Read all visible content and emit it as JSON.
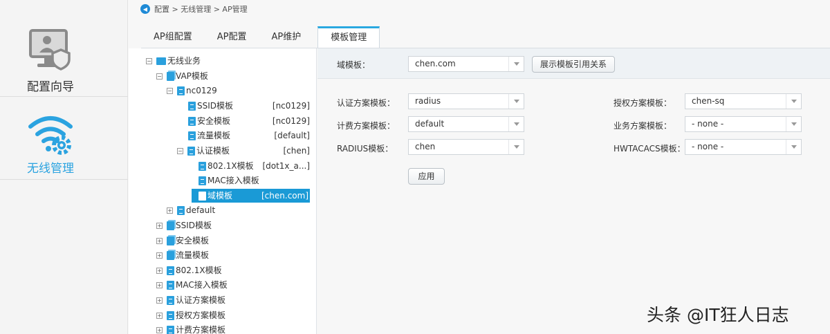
{
  "leftnav": {
    "items": [
      {
        "label": "配置向导",
        "icon": "monitor-shield-icon"
      },
      {
        "label": "无线管理",
        "icon": "wifi-gear-icon",
        "active": true
      }
    ],
    "accent_color": "#2ba3e0"
  },
  "breadcrumb": {
    "text": "配置 > 无线管理 > AP管理",
    "back_icon": "back-arrow-icon"
  },
  "tabs": [
    {
      "label": "AP组配置"
    },
    {
      "label": "AP配置"
    },
    {
      "label": "AP维护"
    },
    {
      "label": "模板管理",
      "active": true
    }
  ],
  "tree": {
    "root": "无线业务",
    "vap": "VAP模板",
    "nc0129": "nc0129",
    "ssid": {
      "label": "SSID模板",
      "tag": "[nc0129]"
    },
    "security": {
      "label": "安全模板",
      "tag": "[nc0129]"
    },
    "traffic": {
      "label": "流量模板",
      "tag": "[default]"
    },
    "auth": {
      "label": "认证模板",
      "tag": "[chen]"
    },
    "dot1x": {
      "label": "802.1X模板",
      "tag": "[dot1x_a...]"
    },
    "mac": {
      "label": "MAC接入模板",
      "tag": ""
    },
    "domain": {
      "label": "域模板",
      "tag": "[chen.com]"
    },
    "default": "default",
    "top_items": [
      "SSID模板",
      "安全模板",
      "流量模板",
      "802.1X模板",
      "MAC接入模板",
      "认证方案模板",
      "授权方案模板",
      "计费方案模板"
    ]
  },
  "form": {
    "domain_label": "域模板：",
    "domain_value": "chen.com",
    "show_ref_button": "展示模板引用关系",
    "auth_scheme_label": "认证方案模板：",
    "auth_scheme_value": "radius",
    "acct_scheme_label": "计费方案模板：",
    "acct_scheme_value": "default",
    "radius_label": "RADIUS模板：",
    "radius_value": "chen",
    "authz_scheme_label": "授权方案模板：",
    "authz_scheme_value": "chen-sq",
    "service_scheme_label": "业务方案模板：",
    "service_scheme_value": "- none -",
    "hwtacacs_label": "HWTACACS模板：",
    "hwtacacs_value": "- none -",
    "apply_button": "应用"
  },
  "watermark": "头条 @IT狂人日志"
}
